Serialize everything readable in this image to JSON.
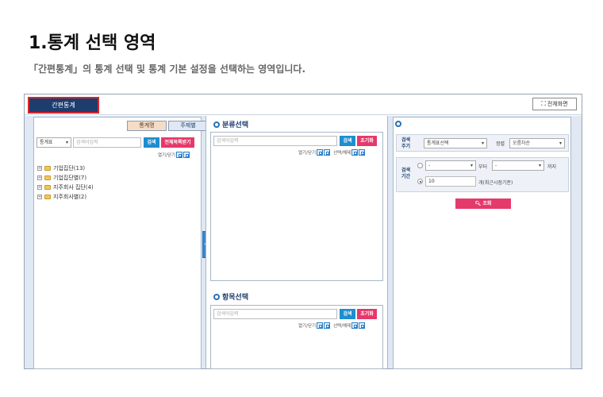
{
  "header": {
    "title": "1.통계 선택 영역",
    "description": "「간편통계」의 통계 선택 및 통계 기본 설정을 선택하는 영역입니다."
  },
  "topbar": {
    "main_tab": "간편통계",
    "fullscreen_label": "전체화면",
    "fullscreen_icon": "expand-icon"
  },
  "left_panel": {
    "subtabs": [
      "통계명",
      "주제별"
    ],
    "search_select": "통계표",
    "search_placeholder": "검색어입력",
    "search_button": "검색",
    "all_list_button": "전체목록받기",
    "toggle_label": "열기/닫기",
    "tree": [
      "기업집단(13)",
      "기업집단별(7)",
      "지주회사 집단(4)",
      "지주회사별(2)"
    ]
  },
  "middle": {
    "category_title": "분류선택",
    "item_title": "항목선택",
    "search_placeholder": "검색어입력",
    "search_button": "검색",
    "reset_button": "초기화",
    "toggle_label": "열기/닫기",
    "select_label": "선택/해제"
  },
  "right_panel": {
    "cycle_label_1": "검색",
    "cycle_label_2": "주기",
    "cycle_select": "통계표선택",
    "sort_label": "정렬",
    "sort_select": "오름차순",
    "period_label_1": "검색",
    "period_label_2": "기간",
    "from_select": "-",
    "from_suffix": "부터",
    "to_select": "-",
    "to_suffix": "까지",
    "count_value": "10",
    "count_suffix": "개(최근시점기준)",
    "query_button": "조회"
  }
}
